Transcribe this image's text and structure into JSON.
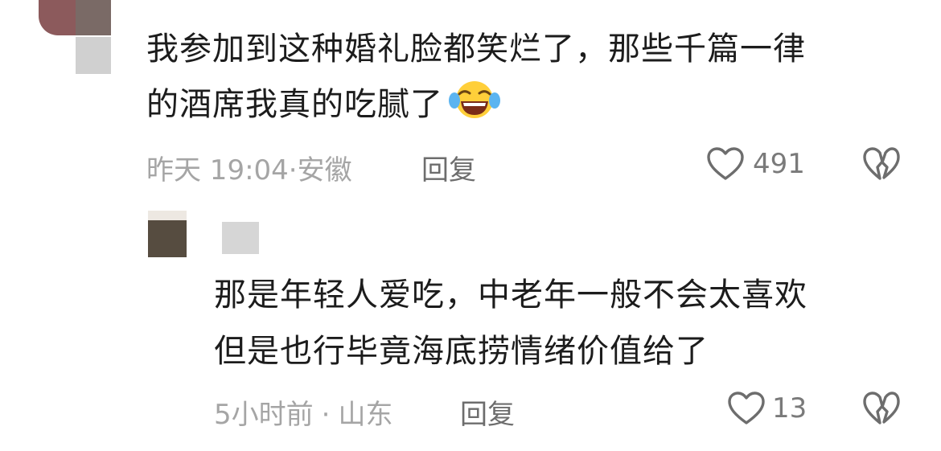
{
  "comments": [
    {
      "text_line1": "我参加到这种婚礼脸都笑烂了，那些千篇一律",
      "text_line2": "的酒席我真的吃腻了",
      "emoji": "crying-laughing-face-emoji",
      "time": "昨天 19:04",
      "separator": "·",
      "location": "安徽",
      "reply_label": "回复",
      "likes": "491"
    },
    {
      "text_line1": "那是年轻人爱吃，中老年一般不会太喜欢",
      "text_line2": "但是也行毕竟海底捞情绪价值给了",
      "time": "5小时前",
      "separator": "·",
      "location": "山东",
      "reply_label": "回复",
      "likes": "13"
    }
  ],
  "icons": {
    "like": "heart-outline-icon",
    "dislike": "broken-heart-icon"
  },
  "colors": {
    "text": "#1c1c1c",
    "meta": "#a5a5a5",
    "reply": "#6d6d6d",
    "icon_stroke": "#6d6d6d"
  }
}
